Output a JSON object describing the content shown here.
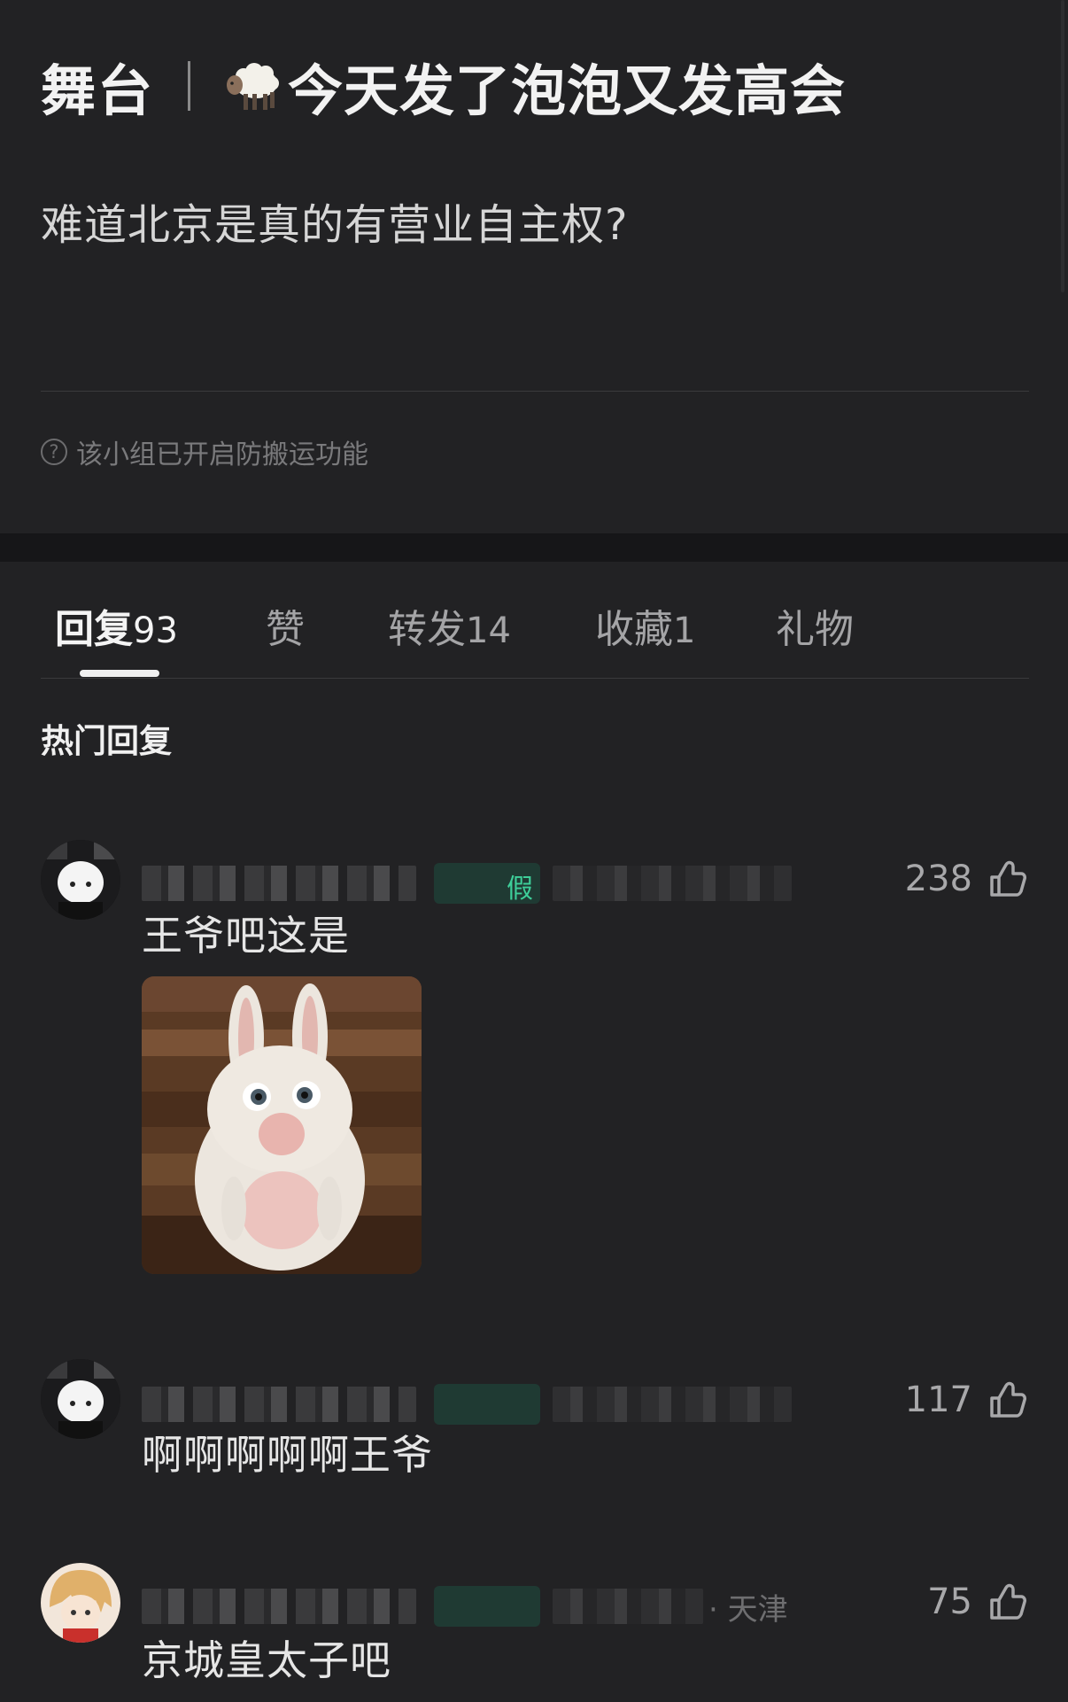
{
  "post": {
    "group_name": "舞台",
    "title": "今天发了泡泡又发高会",
    "body": "难道北京是真的有营业自主权?",
    "notice": "该小组已开启防搬运功能"
  },
  "tabs": [
    {
      "label": "回复",
      "count": "93",
      "active": true
    },
    {
      "label": "赞",
      "count": ""
    },
    {
      "label": "转发",
      "count": "14"
    },
    {
      "label": "收藏",
      "count": "1"
    },
    {
      "label": "礼物",
      "count": ""
    }
  ],
  "section_title": "热门回复",
  "comments": [
    {
      "badge": "假",
      "time_location": "",
      "likes": "238",
      "text": "王爷吧这是",
      "has_image": true,
      "image_desc": "rabbid-bunny-image"
    },
    {
      "badge": "",
      "time_location": "",
      "likes": "117",
      "text": "啊啊啊啊啊王爷",
      "has_image": false
    },
    {
      "badge": "",
      "time_location": "· 天津",
      "likes": "75",
      "text": "京城皇太子吧",
      "has_image": false
    }
  ],
  "colors": {
    "background": "#222224",
    "badge_green": "#3ecf9a",
    "text_primary": "#e6e6e6",
    "text_secondary": "#6e6e70"
  },
  "icons": [
    "sheep-icon",
    "help-icon",
    "thumbs-up-icon"
  ]
}
